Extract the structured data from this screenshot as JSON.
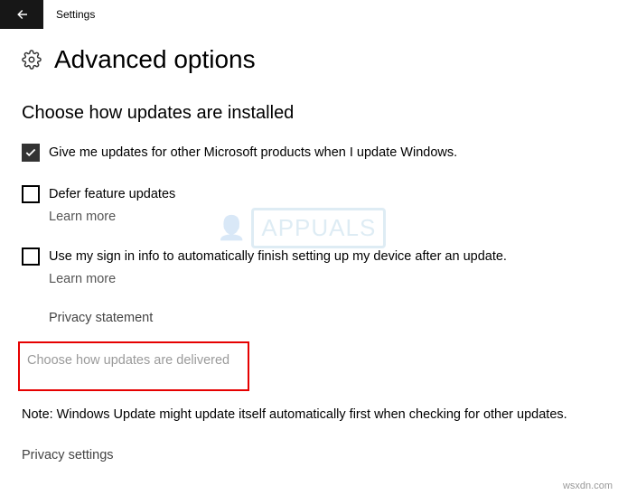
{
  "titlebar": {
    "label": "Settings"
  },
  "header": {
    "title": "Advanced options"
  },
  "section": {
    "title": "Choose how updates are installed"
  },
  "options": {
    "other_products": {
      "label": "Give me updates for other Microsoft products when I update Windows.",
      "checked": true
    },
    "defer": {
      "label": "Defer feature updates",
      "learn_more": "Learn more",
      "checked": false
    },
    "signin": {
      "label": "Use my sign in info to automatically finish setting up my device after an update.",
      "learn_more": "Learn more",
      "checked": false
    }
  },
  "links": {
    "privacy_statement": "Privacy statement",
    "choose_delivery": "Choose how updates are delivered",
    "privacy_settings": "Privacy settings"
  },
  "note": "Note: Windows Update might update itself automatically first when checking for other updates.",
  "watermark": {
    "site": "wsxdn.com",
    "brand": "APPUALS"
  }
}
